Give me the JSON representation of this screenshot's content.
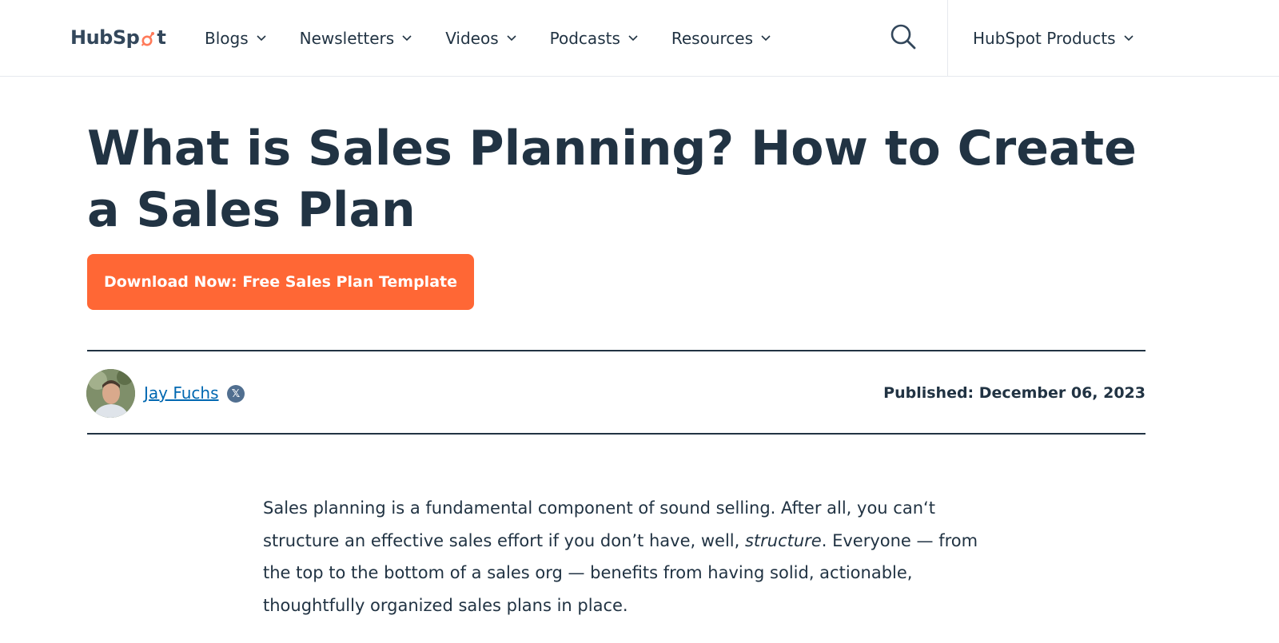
{
  "header": {
    "logo_text_a": "HubSp",
    "logo_text_b": "t",
    "nav": [
      {
        "label": "Blogs"
      },
      {
        "label": "Newsletters"
      },
      {
        "label": "Videos"
      },
      {
        "label": "Podcasts"
      },
      {
        "label": "Resources"
      }
    ],
    "products_label": "HubSpot Products"
  },
  "article": {
    "title": "What is Sales Planning? How to Create a Sales Plan",
    "cta_label": "Download Now: Free Sales Plan Template",
    "author": "Jay Fuchs",
    "social_badge": "𝕏",
    "published": "Published: December 06, 2023",
    "intro_part1": "Sales planning is a fundamental component of sound selling. After all, you can‘t structure an effective sales effort if you don’t have, well, ",
    "intro_emphasis": "structure",
    "intro_part2": ". Everyone — from the top to the bottom of a sales org — benefits from having solid, actionable, thoughtfully organized sales plans in place."
  },
  "colors": {
    "brand_orange": "#ff6735",
    "heading": "#213343",
    "link": "#0068b1"
  }
}
